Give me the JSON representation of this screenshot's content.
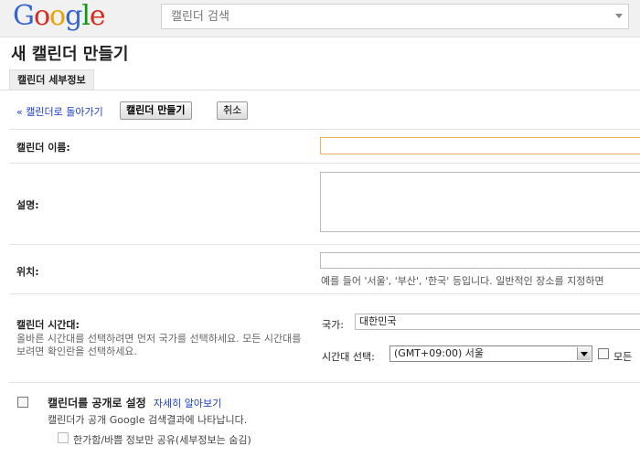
{
  "header": {
    "logo_letters": [
      "G",
      "o",
      "o",
      "g",
      "l",
      "e"
    ],
    "search_placeholder": "캘린더 검색"
  },
  "page": {
    "title": "새 캘린더 만들기",
    "tab_label": "캘린더 세부정보"
  },
  "actions": {
    "back_link": "« 캘린더로 돌아가기",
    "create_button": "캘린더 만들기",
    "cancel_button": "취소"
  },
  "form": {
    "name_label": "캘린더 이름:",
    "name_value": "",
    "description_label": "설명:",
    "description_value": "",
    "location_label": "위치:",
    "location_value": "",
    "location_hint": "예를 들어 '서울', '부산', '한국' 등입니다. 일반적인 장소를 지정하면",
    "timezone_label": "캘린더 시간대:",
    "timezone_desc": "올바른 시간대를 선택하려면 먼저 국가를 선택하세요. 모든 시간대를 보려면 확인란을 선택하세요.",
    "country_label": "국가:",
    "country_value": "대한민국",
    "timezone_select_label": "시간대 선택:",
    "timezone_value": "(GMT+09:00) 서울",
    "show_all_label": "모든",
    "public_label": "캘린더를 공개로 설정",
    "public_learn_more": "자세히 알아보기",
    "public_desc": "캘린더가 공개 Google 검색결과에 나타납니다.",
    "busy_only_label": "한가함/바쁨 정보만 공유(세부정보는 숨김)"
  },
  "colors": {
    "link": "#1a3dc1",
    "focus_border": "#e5b55a"
  }
}
